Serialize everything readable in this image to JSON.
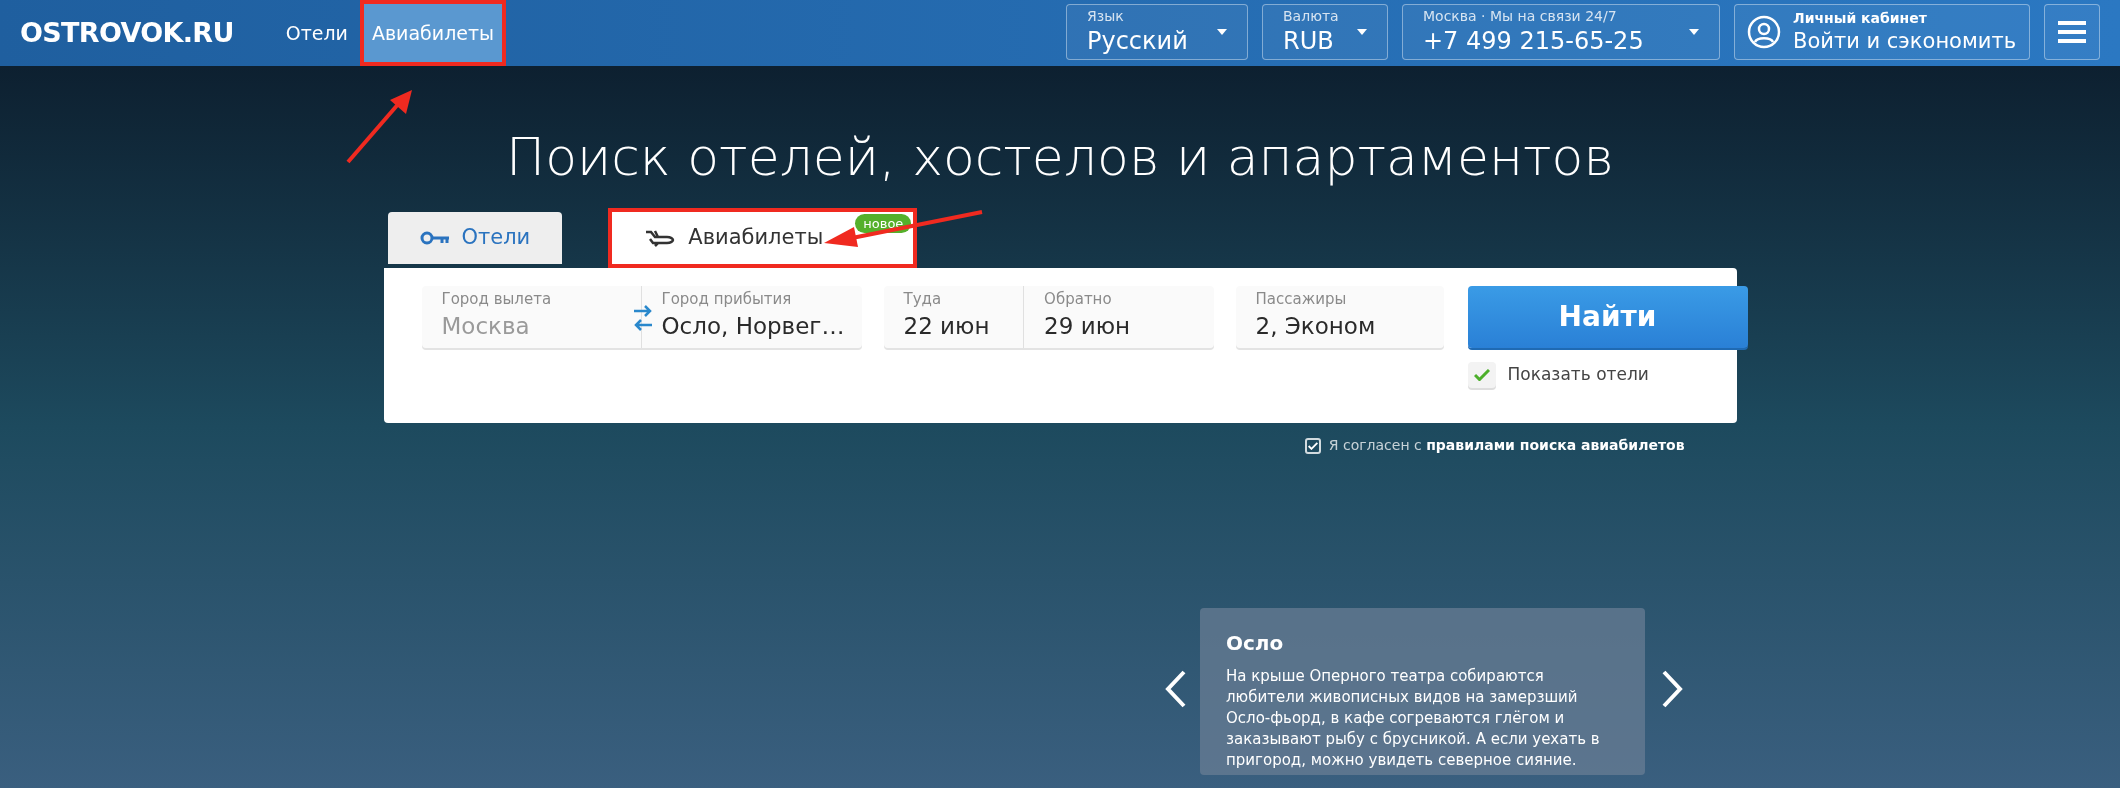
{
  "header": {
    "logo": "OSTROVOK.RU",
    "nav": [
      {
        "label": "Отели",
        "selected": false,
        "highlighted": false
      },
      {
        "label": "Авиабилеты",
        "selected": true,
        "highlighted": true
      }
    ],
    "language": {
      "label": "Язык",
      "value": "Русский"
    },
    "currency": {
      "label": "Валюта",
      "value": "RUB"
    },
    "contact": {
      "city": "Москва",
      "separator": "·",
      "hours": "Мы на связи 24/7",
      "phone": "+7 499 215-65-25"
    },
    "account": {
      "label": "Личный кабинет",
      "action": "Войти и сэкономить"
    }
  },
  "hero": {
    "title": "Поиск отелей, хостелов и апартаментов"
  },
  "search_tabs": [
    {
      "kind": "hotels",
      "label": "Отели",
      "selected": false,
      "highlighted": false
    },
    {
      "kind": "flights",
      "label": "Авиабилеты",
      "selected": true,
      "highlighted": true,
      "badge": "новое"
    }
  ],
  "search_form": {
    "from": {
      "label": "Город вылета",
      "placeholder": "Москва"
    },
    "to": {
      "label": "Город прибытия",
      "value": "Осло, Норвег…"
    },
    "depart": {
      "label": "Туда",
      "value": "22 июн"
    },
    "return": {
      "label": "Обратно",
      "value": "29 июн"
    },
    "passengers": {
      "label": "Пассажиры",
      "value": "2, Эконом"
    },
    "submit": "Найти",
    "show_hotels": {
      "label": "Показать отели",
      "checked": true
    }
  },
  "agreement": {
    "checked": true,
    "text": "Я согласен с **правилами поиска авиабилетов**"
  },
  "caption": {
    "title": "Осло",
    "text": "На крыше Оперного театра собираются любители живописных видов на замерзший Осло-фьорд, в кафе согреваются глёгом и заказывают рыбу с брусникой. А если уехать в пригород, можно увидеть северное сияние."
  }
}
